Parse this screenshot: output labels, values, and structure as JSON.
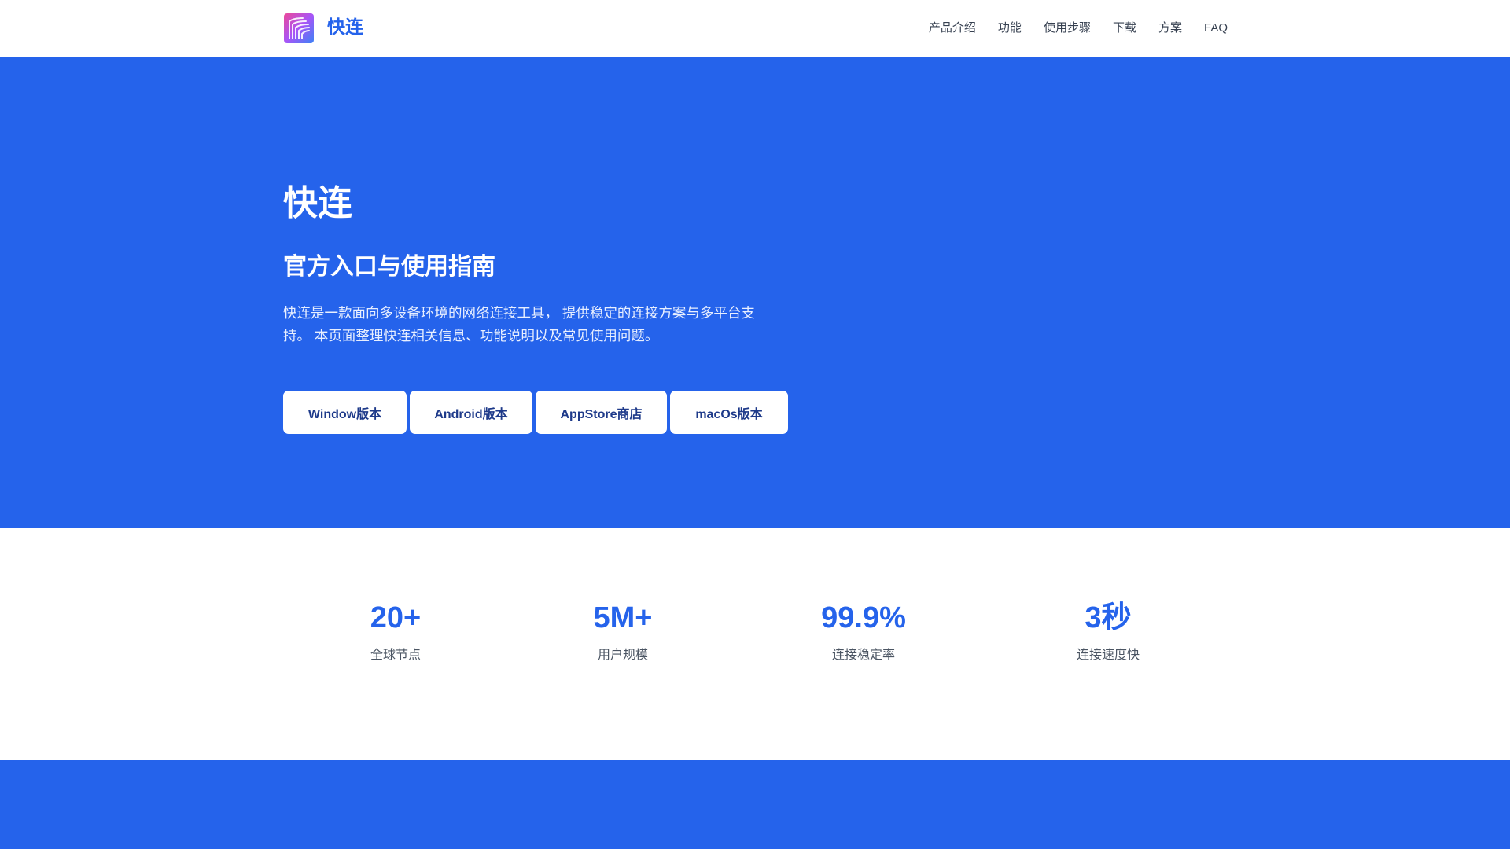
{
  "header": {
    "brand": "快连",
    "nav": [
      "产品介绍",
      "功能",
      "使用步骤",
      "下载",
      "方案",
      "FAQ"
    ]
  },
  "hero": {
    "title": "快连",
    "subtitle": "官方入口与使用指南",
    "description": "快连是一款面向多设备环境的网络连接工具， 提供稳定的连接方案与多平台支持。 本页面整理快连相关信息、功能说明以及常见使用问题。",
    "buttons": [
      "Window版本",
      "Android版本",
      "AppStore商店",
      "macOs版本"
    ]
  },
  "stats": [
    {
      "value": "20+",
      "label": "全球节点"
    },
    {
      "value": "5M+",
      "label": "用户规模"
    },
    {
      "value": "99.9%",
      "label": "连接稳定率"
    },
    {
      "value": "3秒",
      "label": "连接速度快"
    }
  ],
  "colors": {
    "primary": "#2563eb",
    "button_text": "#1e3a8a",
    "nav_text": "#374151",
    "stat_label": "#4b5563"
  },
  "icons": {
    "logo": "brand-logo-icon"
  }
}
